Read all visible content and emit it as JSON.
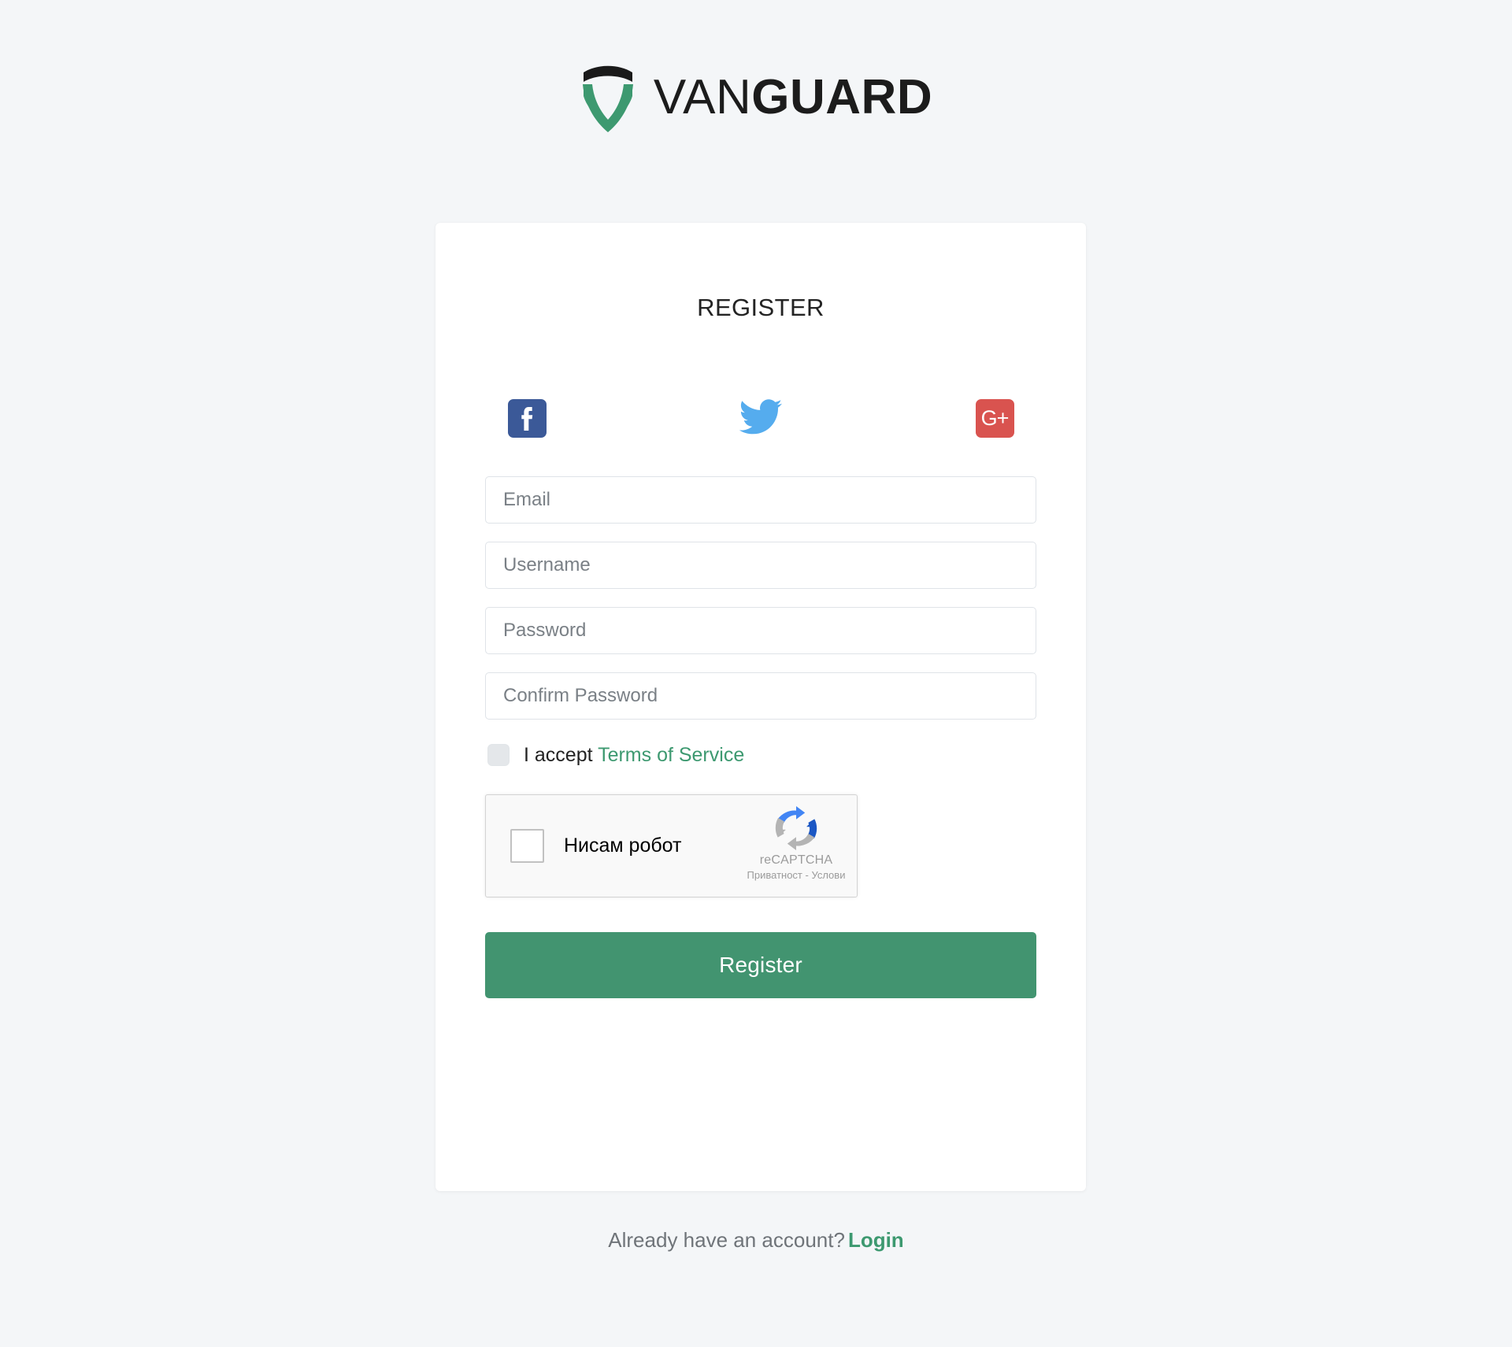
{
  "brand": {
    "logo_icon": "vanguard-shield-icon",
    "name_light": "VAN",
    "name_bold": "GUARD",
    "colors": {
      "shield_top": "#1a1a1a",
      "shield_green": "#3d9970",
      "wordmark": "#1c1c1c"
    }
  },
  "card": {
    "title": "REGISTER",
    "social": {
      "facebook": {
        "icon": "facebook-icon",
        "label": "f",
        "color": "#3b5998"
      },
      "twitter": {
        "icon": "twitter-icon",
        "label": "",
        "color": "#55acee"
      },
      "googleplus": {
        "icon": "google-plus-icon",
        "label": "G+",
        "color": "#d9534f"
      }
    },
    "fields": [
      {
        "name": "email",
        "placeholder": "Email",
        "value": "",
        "type": "text"
      },
      {
        "name": "username",
        "placeholder": "Username",
        "value": "",
        "type": "text"
      },
      {
        "name": "password",
        "placeholder": "Password",
        "value": "",
        "type": "text"
      },
      {
        "name": "confirm_password",
        "placeholder": "Confirm Password",
        "value": "",
        "type": "text"
      }
    ],
    "terms": {
      "accept_text": "I accept",
      "link_text": "Terms of Service",
      "checked": false,
      "link_color": "#3d9970"
    },
    "recaptcha": {
      "label": "Нисам робот",
      "brand_name": "reCAPTCHA",
      "legal": "Приватност - Услови",
      "checked": false,
      "logo_icon": "recaptcha-logo-icon"
    },
    "submit": {
      "label": "Register",
      "color": "#429470"
    }
  },
  "footer": {
    "prompt": "Already have an account?",
    "login_label": "Login",
    "login_color": "#3d9970"
  }
}
